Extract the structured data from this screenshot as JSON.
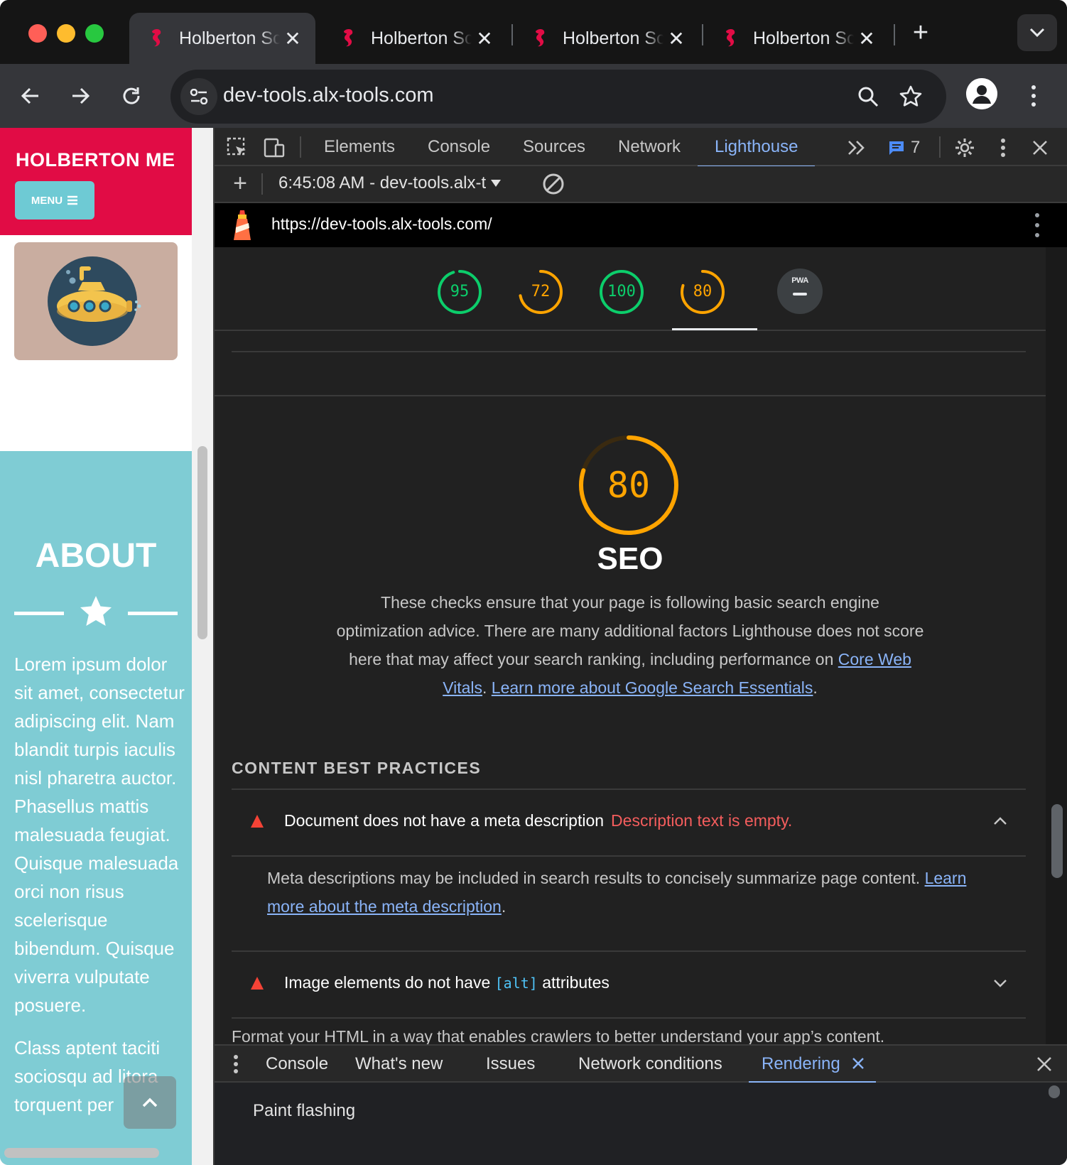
{
  "browser": {
    "tabs": [
      {
        "title": "Holberton School",
        "active": true
      },
      {
        "title": "Holberton School",
        "active": false
      },
      {
        "title": "Holberton School",
        "active": false
      },
      {
        "title": "Holberton School",
        "active": false
      }
    ],
    "url": "dev-tools.alx-tools.com"
  },
  "page": {
    "site_title": "HOLBERTON ME",
    "menu_label": "MENU",
    "about_title": "ABOUT",
    "paragraphs": [
      "Lorem ipsum dolor sit amet, consectetur adipiscing elit. Nam blandit turpis iaculis nisl pharetra auctor. Phasellus mattis malesuada feugiat. Quisque malesuada orci non risus scelerisque bibendum. Quisque viverra vulputate posuere.",
      "Class aptent taciti sociosqu ad litora torquent per"
    ]
  },
  "devtools": {
    "tabs": [
      "Elements",
      "Console",
      "Sources",
      "Network",
      "Lighthouse"
    ],
    "active_tab": "Lighthouse",
    "issues_count": "7",
    "report_selector": "6:45:08 AM - dev-tools.alx-t",
    "lighthouse": {
      "report_url": "https://dev-tools.alx-tools.com/",
      "scores": [
        {
          "value": "95",
          "score": 95,
          "color": "#0cce6b"
        },
        {
          "value": "72",
          "score": 72,
          "color": "#ffa400"
        },
        {
          "value": "100",
          "score": 100,
          "color": "#0cce6b"
        },
        {
          "value": "80",
          "score": 80,
          "color": "#ffa400"
        }
      ],
      "pwa_label": "PWA",
      "category": {
        "score": "80",
        "score_value": 80,
        "color": "#ffa400",
        "title": "SEO",
        "description_prefix": "These checks ensure that your page is following basic search engine optimization advice. There are many additional factors Lighthouse does not score here that may affect your search ranking, including performance on ",
        "link1": "Core Web Vitals",
        "between": ". ",
        "link2": "Learn more about Google Search Essentials",
        "suffix": "."
      },
      "group_title": "CONTENT BEST PRACTICES",
      "audits": [
        {
          "title": "Document does not have a meta description",
          "display_value": "Description text is empty.",
          "expanded": true,
          "description": "Meta descriptions may be included in search results to concisely summarize page content. ",
          "link": "Learn more about the meta description",
          "link_suffix": "."
        },
        {
          "title_before": "Image elements do not have ",
          "code": "[alt]",
          "title_after": " attributes",
          "expanded": false
        }
      ],
      "group_description": "Format your HTML in a way that enables crawlers to better understand your app’s content."
    },
    "drawer": {
      "tabs": [
        "Console",
        "What's new",
        "Issues",
        "Network conditions",
        "Rendering"
      ],
      "active_tab": "Rendering",
      "first_item": "Paint flashing"
    }
  },
  "colors": {
    "header_red": "#e10c45",
    "about_teal": "#7fccd4",
    "link_blue": "#8ab4f8",
    "fail_red": "#f45d5d"
  }
}
